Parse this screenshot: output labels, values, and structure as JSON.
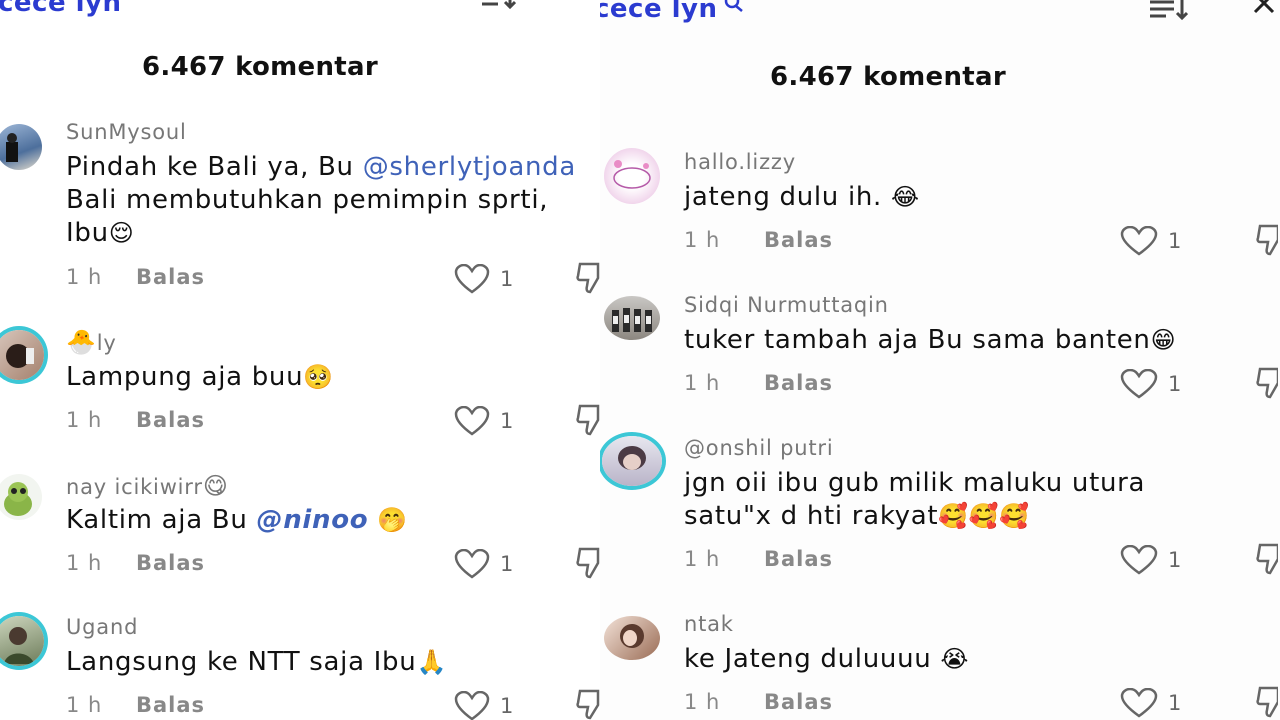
{
  "left": {
    "header_title": "cece lyn",
    "comment_count": "6.467 komentar",
    "comments": [
      {
        "username": "SunMysoul",
        "line1_a": "Pindah ke Bali ya, Bu ",
        "line1_mention": "@sherlytjoanda",
        "line2": "Bali membutuhkan pemimpin sprti,",
        "line3_text": "Ibu",
        "line3_emoji": "😌",
        "time": "1 h",
        "reply": "Balas",
        "likes": "1"
      },
      {
        "username_emoji": "🐣",
        "username": "ly",
        "text": "Lampung aja buu",
        "emoji": "🥺",
        "time": "1 h",
        "reply": "Balas",
        "likes": "1"
      },
      {
        "username": "nay icikiwirr",
        "username_emoji": "😋",
        "text_a": "Kaltim aja Bu ",
        "mention": "@ninoo",
        "emoji": "🤭",
        "time": "1 h",
        "reply": "Balas",
        "likes": "1"
      },
      {
        "username": "Ugand",
        "text": "Langsung ke NTT saja Ibu",
        "emoji": "🙏",
        "time": "1 h",
        "reply": "Balas",
        "likes": "1"
      }
    ]
  },
  "right": {
    "header_title": "cece lyn",
    "comment_count": "6.467 komentar",
    "comments": [
      {
        "username": "hallo.lizzy",
        "text": "jateng dulu ih. ",
        "emoji": "😂",
        "time": "1 h",
        "reply": "Balas",
        "likes": "1"
      },
      {
        "username": "Sidqi Nurmuttaqin",
        "text": "tuker tambah aja Bu sama banten",
        "emoji": "😁",
        "time": "1 h",
        "reply": "Balas",
        "likes": "1"
      },
      {
        "username": "@onshil putri",
        "line1": "jgn oii ibu gub milik maluku utura",
        "line2": "satu\"x d hti rakyat",
        "emoji": "🥰🥰🥰",
        "time": "1 h",
        "reply": "Balas",
        "likes": "1"
      },
      {
        "username": "ntak",
        "text": "ke Jateng duluuuu ",
        "emoji": "😭",
        "time": "1 h",
        "reply": "Balas",
        "likes": "1"
      }
    ]
  },
  "icons": {
    "sort": "sort-icon",
    "search": "search-icon",
    "close": "close-icon",
    "like": "heart-icon",
    "dislike": "thumbs-down-icon"
  },
  "colors": {
    "accent": "#2b3bd0",
    "mention": "#3f62b8",
    "ring": "#3cc7d6"
  }
}
